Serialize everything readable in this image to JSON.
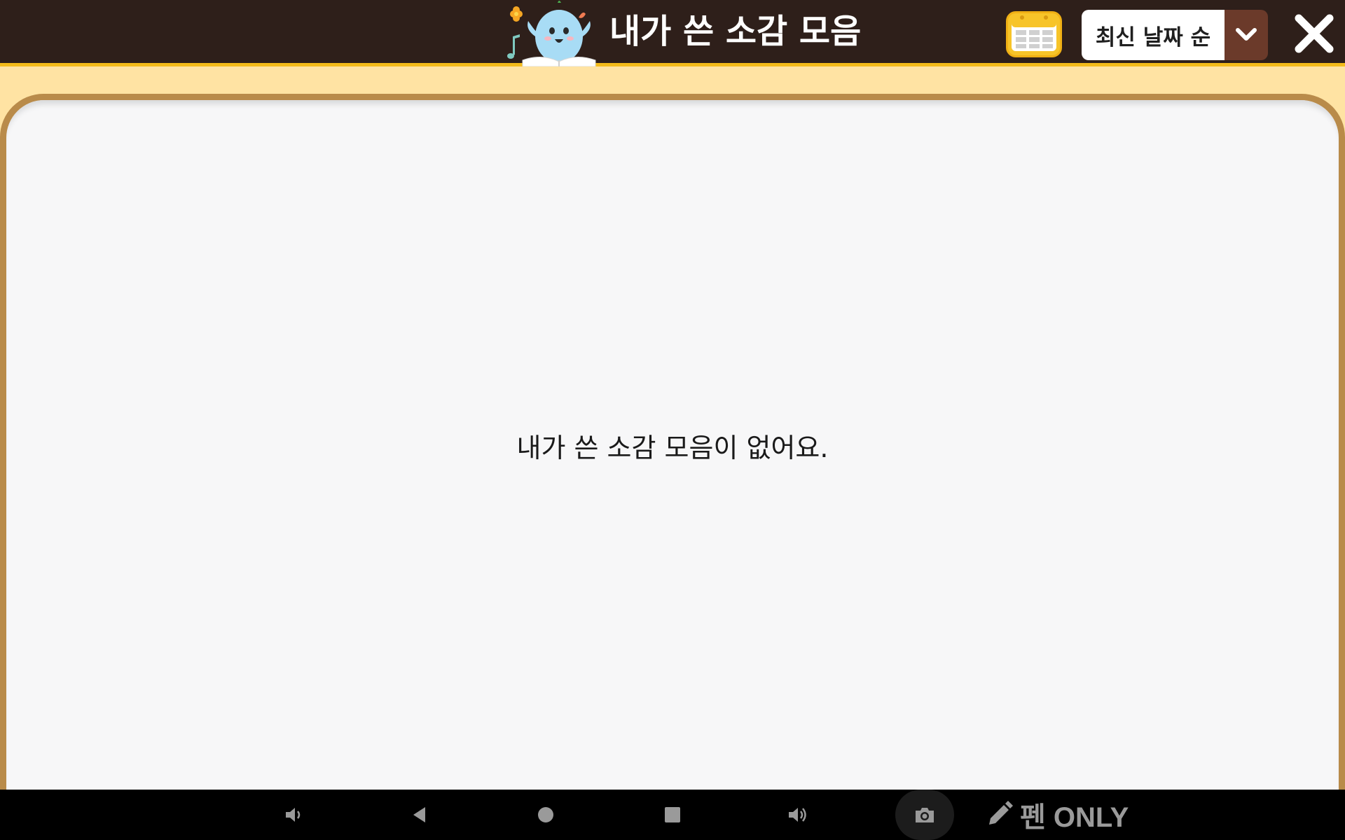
{
  "header": {
    "title": "내가 쓴 소감 모음",
    "mascot_icon": "mascot-reading-book-icon",
    "calendar_icon": "calendar-icon",
    "sort": {
      "selected": "최신 날짜 순",
      "arrow_icon": "chevron-down-icon"
    },
    "close_icon": "close-icon"
  },
  "main": {
    "empty_message": "내가 쓴 소감 모음이 없어요."
  },
  "navbar": {
    "items": [
      "volume-down-icon",
      "back-icon",
      "home-icon",
      "recents-icon",
      "volume-up-icon",
      "camera-icon"
    ],
    "pen_only_label": "펜 ONLY",
    "pen_icon": "pencil-icon"
  },
  "colors": {
    "header_bg": "#2e1f1a",
    "header_accent": "#f4bb1a",
    "page_bg": "#ffe3a3",
    "board_frame": "#b98b4a",
    "board_surface": "#f7f7f8",
    "sort_arrow_bg": "#6b3a2a",
    "calendar_yellow": "#f7c429"
  }
}
